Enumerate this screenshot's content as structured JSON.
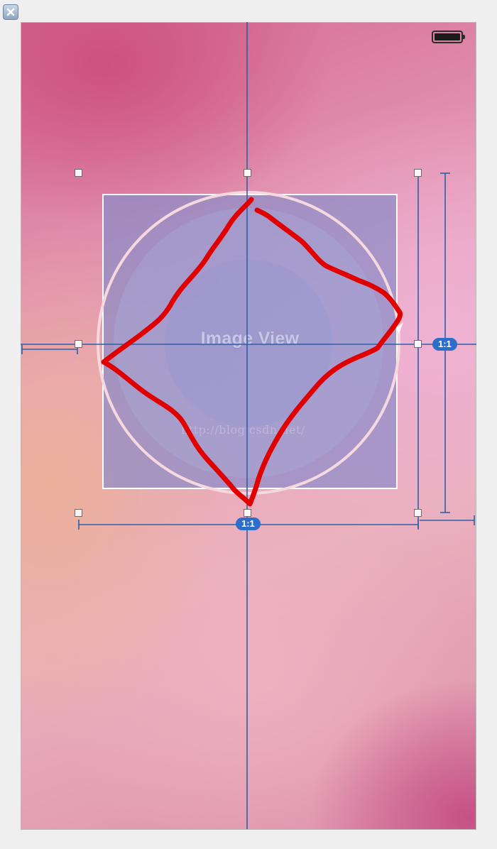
{
  "window": {
    "close_icon": "close-icon"
  },
  "status_bar": {
    "battery_icon": "battery-icon"
  },
  "image_view": {
    "label": "Image View"
  },
  "constraints": {
    "aspect_ratio_horizontal": "1:1",
    "aspect_ratio_vertical": "1:1"
  },
  "watermark": {
    "text": "http://blog.csdn.net/"
  },
  "colors": {
    "constraint_line": "#2e5fa8",
    "badge": "#2e6ecb",
    "annotation_stroke": "#e00000"
  }
}
